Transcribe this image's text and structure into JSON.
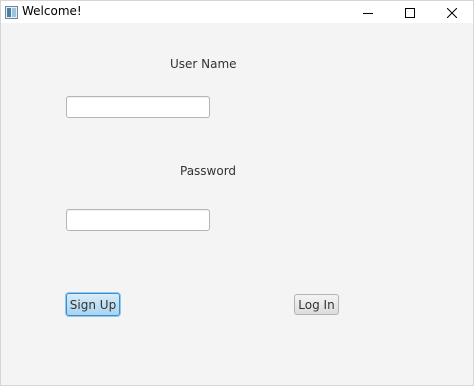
{
  "window": {
    "title": "Welcome!",
    "controls": {
      "minimize_icon": "minimize-icon",
      "maximize_icon": "maximize-icon",
      "close_icon": "close-icon"
    }
  },
  "form": {
    "username_label": "User Name",
    "username_value": "",
    "password_label": "Password",
    "password_value": "",
    "signup_label": "Sign Up",
    "login_label": "Log In"
  },
  "colors": {
    "background": "#f4f4f4",
    "focus_accent": "#3c8fce"
  }
}
